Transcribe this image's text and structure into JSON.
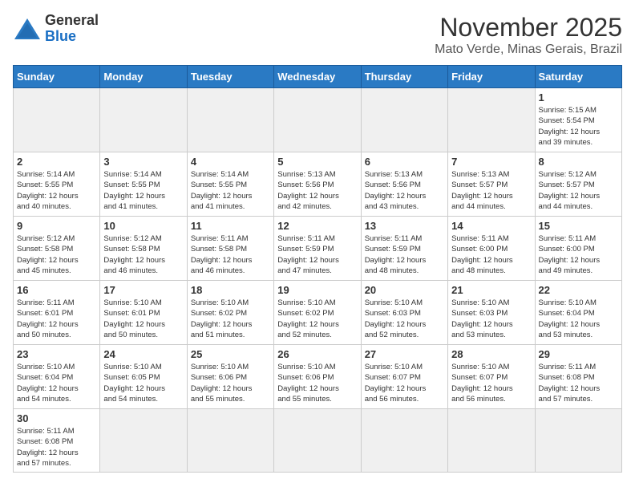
{
  "header": {
    "logo_general": "General",
    "logo_blue": "Blue",
    "month": "November 2025",
    "location": "Mato Verde, Minas Gerais, Brazil"
  },
  "weekdays": [
    "Sunday",
    "Monday",
    "Tuesday",
    "Wednesday",
    "Thursday",
    "Friday",
    "Saturday"
  ],
  "weeks": [
    [
      {
        "day": "",
        "info": ""
      },
      {
        "day": "",
        "info": ""
      },
      {
        "day": "",
        "info": ""
      },
      {
        "day": "",
        "info": ""
      },
      {
        "day": "",
        "info": ""
      },
      {
        "day": "",
        "info": ""
      },
      {
        "day": "1",
        "info": "Sunrise: 5:15 AM\nSunset: 5:54 PM\nDaylight: 12 hours\nand 39 minutes."
      }
    ],
    [
      {
        "day": "2",
        "info": "Sunrise: 5:14 AM\nSunset: 5:55 PM\nDaylight: 12 hours\nand 40 minutes."
      },
      {
        "day": "3",
        "info": "Sunrise: 5:14 AM\nSunset: 5:55 PM\nDaylight: 12 hours\nand 41 minutes."
      },
      {
        "day": "4",
        "info": "Sunrise: 5:14 AM\nSunset: 5:55 PM\nDaylight: 12 hours\nand 41 minutes."
      },
      {
        "day": "5",
        "info": "Sunrise: 5:13 AM\nSunset: 5:56 PM\nDaylight: 12 hours\nand 42 minutes."
      },
      {
        "day": "6",
        "info": "Sunrise: 5:13 AM\nSunset: 5:56 PM\nDaylight: 12 hours\nand 43 minutes."
      },
      {
        "day": "7",
        "info": "Sunrise: 5:13 AM\nSunset: 5:57 PM\nDaylight: 12 hours\nand 44 minutes."
      },
      {
        "day": "8",
        "info": "Sunrise: 5:12 AM\nSunset: 5:57 PM\nDaylight: 12 hours\nand 44 minutes."
      }
    ],
    [
      {
        "day": "9",
        "info": "Sunrise: 5:12 AM\nSunset: 5:58 PM\nDaylight: 12 hours\nand 45 minutes."
      },
      {
        "day": "10",
        "info": "Sunrise: 5:12 AM\nSunset: 5:58 PM\nDaylight: 12 hours\nand 46 minutes."
      },
      {
        "day": "11",
        "info": "Sunrise: 5:11 AM\nSunset: 5:58 PM\nDaylight: 12 hours\nand 46 minutes."
      },
      {
        "day": "12",
        "info": "Sunrise: 5:11 AM\nSunset: 5:59 PM\nDaylight: 12 hours\nand 47 minutes."
      },
      {
        "day": "13",
        "info": "Sunrise: 5:11 AM\nSunset: 5:59 PM\nDaylight: 12 hours\nand 48 minutes."
      },
      {
        "day": "14",
        "info": "Sunrise: 5:11 AM\nSunset: 6:00 PM\nDaylight: 12 hours\nand 48 minutes."
      },
      {
        "day": "15",
        "info": "Sunrise: 5:11 AM\nSunset: 6:00 PM\nDaylight: 12 hours\nand 49 minutes."
      }
    ],
    [
      {
        "day": "16",
        "info": "Sunrise: 5:11 AM\nSunset: 6:01 PM\nDaylight: 12 hours\nand 50 minutes."
      },
      {
        "day": "17",
        "info": "Sunrise: 5:10 AM\nSunset: 6:01 PM\nDaylight: 12 hours\nand 50 minutes."
      },
      {
        "day": "18",
        "info": "Sunrise: 5:10 AM\nSunset: 6:02 PM\nDaylight: 12 hours\nand 51 minutes."
      },
      {
        "day": "19",
        "info": "Sunrise: 5:10 AM\nSunset: 6:02 PM\nDaylight: 12 hours\nand 52 minutes."
      },
      {
        "day": "20",
        "info": "Sunrise: 5:10 AM\nSunset: 6:03 PM\nDaylight: 12 hours\nand 52 minutes."
      },
      {
        "day": "21",
        "info": "Sunrise: 5:10 AM\nSunset: 6:03 PM\nDaylight: 12 hours\nand 53 minutes."
      },
      {
        "day": "22",
        "info": "Sunrise: 5:10 AM\nSunset: 6:04 PM\nDaylight: 12 hours\nand 53 minutes."
      }
    ],
    [
      {
        "day": "23",
        "info": "Sunrise: 5:10 AM\nSunset: 6:04 PM\nDaylight: 12 hours\nand 54 minutes."
      },
      {
        "day": "24",
        "info": "Sunrise: 5:10 AM\nSunset: 6:05 PM\nDaylight: 12 hours\nand 54 minutes."
      },
      {
        "day": "25",
        "info": "Sunrise: 5:10 AM\nSunset: 6:06 PM\nDaylight: 12 hours\nand 55 minutes."
      },
      {
        "day": "26",
        "info": "Sunrise: 5:10 AM\nSunset: 6:06 PM\nDaylight: 12 hours\nand 55 minutes."
      },
      {
        "day": "27",
        "info": "Sunrise: 5:10 AM\nSunset: 6:07 PM\nDaylight: 12 hours\nand 56 minutes."
      },
      {
        "day": "28",
        "info": "Sunrise: 5:10 AM\nSunset: 6:07 PM\nDaylight: 12 hours\nand 56 minutes."
      },
      {
        "day": "29",
        "info": "Sunrise: 5:11 AM\nSunset: 6:08 PM\nDaylight: 12 hours\nand 57 minutes."
      }
    ],
    [
      {
        "day": "30",
        "info": "Sunrise: 5:11 AM\nSunset: 6:08 PM\nDaylight: 12 hours\nand 57 minutes."
      },
      {
        "day": "",
        "info": ""
      },
      {
        "day": "",
        "info": ""
      },
      {
        "day": "",
        "info": ""
      },
      {
        "day": "",
        "info": ""
      },
      {
        "day": "",
        "info": ""
      },
      {
        "day": "",
        "info": ""
      }
    ]
  ]
}
